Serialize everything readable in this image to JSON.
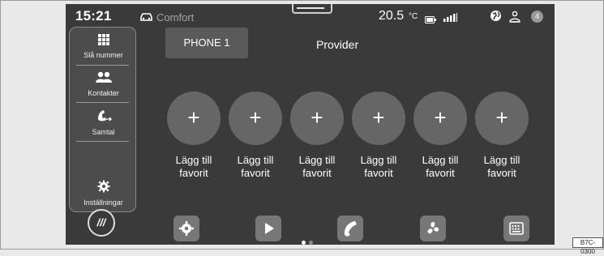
{
  "status_bar": {
    "time": "15:21",
    "profile": "Comfort",
    "temperature": "20.5",
    "temperature_unit": "°C",
    "notification_count": "4"
  },
  "sidebar": {
    "items": [
      {
        "label": "Slå nummer",
        "icon": "keypad-icon"
      },
      {
        "label": "Kontakter",
        "icon": "contacts-icon"
      },
      {
        "label": "Samtal",
        "icon": "call-log-icon"
      },
      {
        "label": "Inställningar",
        "icon": "gear-icon"
      }
    ]
  },
  "main": {
    "phone_tab": "PHONE 1",
    "provider": "Provider",
    "favorites": [
      {
        "label_line1": "Lägg till",
        "label_line2": "favorit"
      },
      {
        "label_line1": "Lägg till",
        "label_line2": "favorit"
      },
      {
        "label_line1": "Lägg till",
        "label_line2": "favorit"
      },
      {
        "label_line1": "Lägg till",
        "label_line2": "favorit"
      },
      {
        "label_line1": "Lägg till",
        "label_line2": "favorit"
      },
      {
        "label_line1": "Lägg till",
        "label_line2": "favorit"
      }
    ],
    "add_symbol": "+"
  },
  "dock": {
    "home_label": "///",
    "buttons": [
      "settings-icon",
      "play-icon",
      "phone-icon",
      "fan-icon",
      "keyboard-icon"
    ],
    "page_dots": {
      "count": 2,
      "active": 1
    }
  },
  "figure_code": "B7C-0300",
  "colors": {
    "screen_bg": "#3a3a3a",
    "tile_bg": "#666666",
    "dock_button": "#777777",
    "text": "#ffffff"
  }
}
